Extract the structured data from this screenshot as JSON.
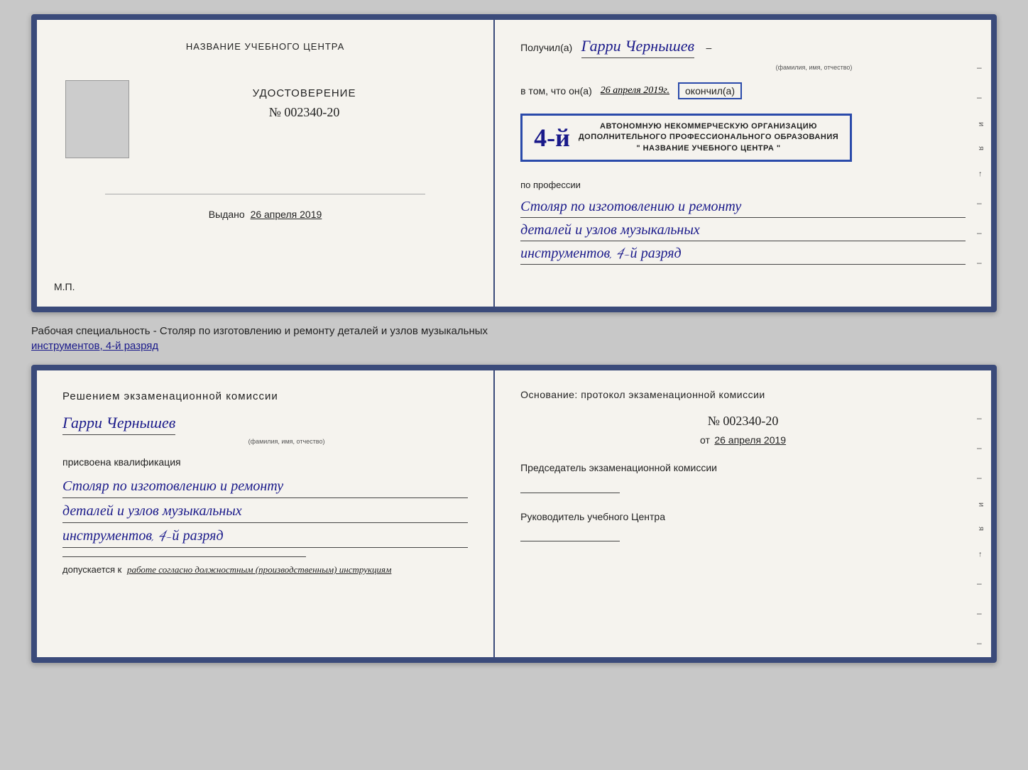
{
  "diploma": {
    "left": {
      "org_name_header": "НАЗВАНИЕ УЧЕБНОГО ЦЕНТРА",
      "udostoverenie": "УДОСТОВЕРЕНИЕ",
      "number": "№ 002340-20",
      "issued_label": "Выдано",
      "issued_date": "26 апреля 2019",
      "mp_label": "М.П."
    },
    "right": {
      "poluchil_label": "Получил(а)",
      "recipient_name": "Гарри Чернышев",
      "fio_hint": "(фамилия, имя, отчество)",
      "vtom_label": "в том, что он(а)",
      "vtom_date": "26 апреля 2019г.",
      "okonchil_label": "окончил(а)",
      "rank": "4-й",
      "stamp_line1": "АВТОНОМНУЮ НЕКОММЕРЧЕСКУЮ ОРГАНИЗАЦИЮ",
      "stamp_line2": "ДОПОЛНИТЕЛЬНОГО ПРОФЕССИОНАЛЬНОГО ОБРАЗОВАНИЯ",
      "stamp_line3": "\" НАЗВАНИЕ УЧЕБНОГО ЦЕНТРА \"",
      "profession_label": "по профессии",
      "profession_line1": "Столяр по изготовлению и ремонту",
      "profession_line2": "деталей и узлов музыкальных",
      "profession_line3": "инструментов, 4-й разряд"
    }
  },
  "description": {
    "text_before_underline": "Рабочая специальность - Столяр по изготовлению и ремонту деталей и узлов музыкальных",
    "text_underline": "инструментов, 4-й разряд"
  },
  "qualification": {
    "left": {
      "title": "Решением  экзаменационной  комиссии",
      "name": "Гарри Чернышев",
      "fio_hint": "(фамилия, имя, отчество)",
      "prisvoena_label": "присвоена квалификация",
      "profession_line1": "Столяр по изготовлению и ремонту",
      "profession_line2": "деталей и узлов музыкальных",
      "profession_line3": "инструментов, 4-й разряд",
      "dopuskaetsya_label": "допускается к",
      "dopuskaetsya_text": "работе согласно должностным (производственным) инструкциям"
    },
    "right": {
      "title": "Основание: протокол  экзаменационной  комиссии",
      "number": "№  002340-20",
      "date_prefix": "от",
      "date": "26 апреля 2019",
      "predsedatel_label": "Председатель экзаменационной комиссии",
      "rukovoditel_label": "Руководитель учебного Центра"
    }
  },
  "side_letters": {
    "i": "и",
    "ya": "я",
    "arrow": "←"
  }
}
